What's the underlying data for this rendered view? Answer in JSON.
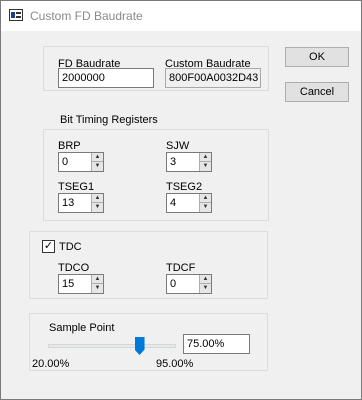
{
  "window": {
    "title": "Custom FD Baudrate",
    "icon": "app-icon"
  },
  "baudrate": {
    "fd_label": "FD Baudrate",
    "fd_value": "2000000",
    "custom_label": "Custom Baudrate",
    "custom_value": "800F00A0032D43"
  },
  "buttons": {
    "ok": "OK",
    "cancel": "Cancel"
  },
  "bit_timing": {
    "heading": "Bit Timing Registers",
    "brp": {
      "label": "BRP",
      "value": "0"
    },
    "sjw": {
      "label": "SJW",
      "value": "3"
    },
    "tseg1": {
      "label": "TSEG1",
      "value": "13"
    },
    "tseg2": {
      "label": "TSEG2",
      "value": "4"
    }
  },
  "tdc": {
    "checkbox_label": "TDC",
    "checked": true,
    "checkmark": "✓",
    "tdco": {
      "label": "TDCO",
      "value": "15"
    },
    "tdcf": {
      "label": "TDCF",
      "value": "0"
    }
  },
  "sample_point": {
    "label": "Sample Point",
    "value": "75.00%",
    "min_label": "20.00%",
    "max_label": "95.00%",
    "min": 20,
    "max": 95,
    "current": 75
  },
  "spin_glyphs": {
    "up": "▲",
    "down": "▼"
  },
  "colors": {
    "accent": "#0078d7"
  }
}
